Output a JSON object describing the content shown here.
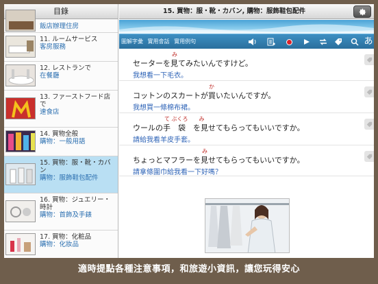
{
  "sidebar": {
    "header": "目錄",
    "items": [
      {
        "title": "",
        "subtitle": "飯店辦理住房",
        "selected": false
      },
      {
        "title": "11. ルームサービス",
        "subtitle": "客房服務",
        "selected": false
      },
      {
        "title": "12. レストランで",
        "subtitle": "在餐廳",
        "selected": false
      },
      {
        "title": "13. ファーストフード店で",
        "subtitle": "速食店",
        "selected": false
      },
      {
        "title": "14. 買物全般",
        "subtitle": "購物：一般用語",
        "selected": false
      },
      {
        "title": "15. 買物：服・靴・カバン",
        "subtitle": "購物：服飾鞋包配件",
        "selected": true
      },
      {
        "title": "16. 買物：ジュエリー・時計",
        "subtitle": "購物：首飾及手錶",
        "selected": false
      },
      {
        "title": "17. 買物：化粧品",
        "subtitle": "購物：化妝品",
        "selected": false
      }
    ]
  },
  "main": {
    "title": "15. 買物：服・靴・カバン, 購物：服飾鞋包配件",
    "toolbar": {
      "labels": [
        "圖解字彙",
        "實用會話",
        "實用例句"
      ],
      "icons": [
        "speaker-icon",
        "playlist-icon",
        "record-icon",
        "play-icon",
        "repeat-icon",
        "tag-icon",
        "search-icon",
        "kana-icon"
      ],
      "kana_label": "あ"
    },
    "sentences": [
      {
        "jp": "セーターを見てみたいんですけど。",
        "furigana": "み",
        "zh": "我想看一下毛衣。"
      },
      {
        "jp": "コットンのスカートが買いたいんですが。",
        "furigana": "か",
        "zh": "我想買一條棉布裙。"
      },
      {
        "jp": "ウールの手　袋　を見せてもらってもいいですか。",
        "furigana": "て ぶくろ　　み",
        "zh": "請給我看羊皮手套。"
      },
      {
        "jp": "ちょっとマフラーを見せてもらってもいいですか。",
        "furigana": "み",
        "zh": "請拿條圍巾給我看一下好嗎？"
      }
    ]
  },
  "caption": "適時提點各種注意事項，和旅遊小資訊，讓您玩得安心",
  "colors": {
    "accent": "#2f64b7",
    "toolbar": "#2a6f9d",
    "furigana": "#c0302b",
    "selected": "#b9dff3"
  }
}
